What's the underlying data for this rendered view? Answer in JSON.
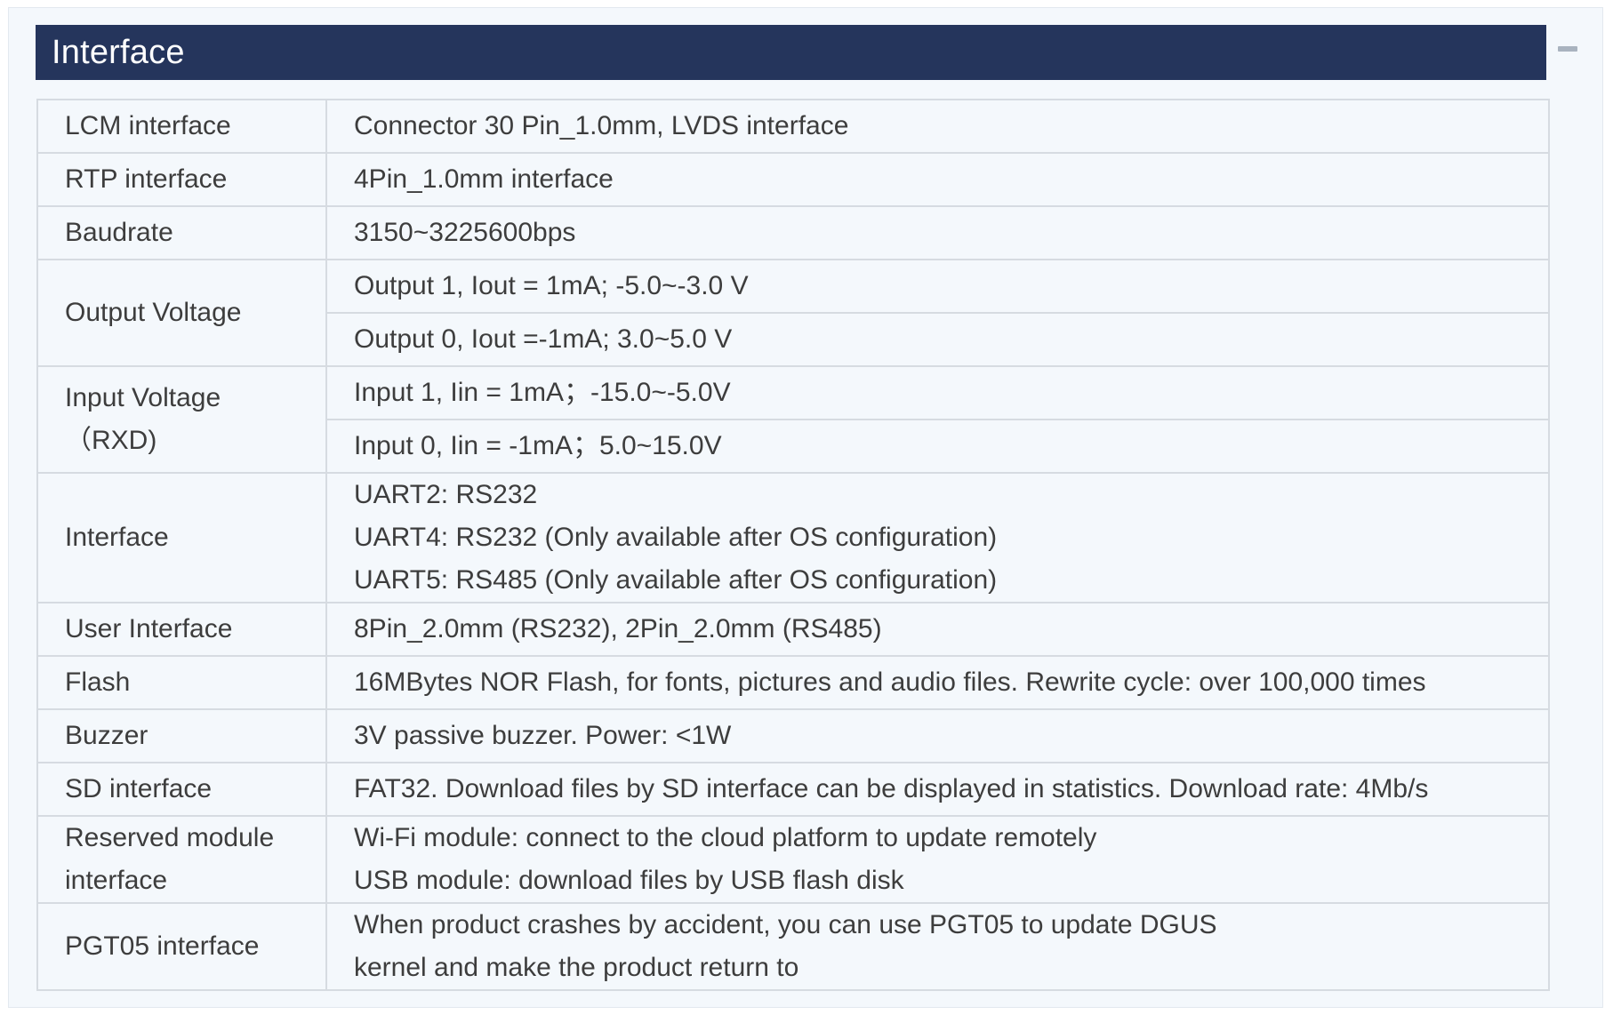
{
  "section": {
    "title": "Interface"
  },
  "table": {
    "lcm": {
      "label": "LCM interface",
      "value": "Connector 30 Pin_1.0mm, LVDS interface"
    },
    "rtp": {
      "label": "RTP interface",
      "value": "4Pin_1.0mm interface"
    },
    "baudrate": {
      "label": "Baudrate",
      "value": "3150~3225600bps"
    },
    "output_voltage": {
      "label": "Output Voltage",
      "values": [
        "Output 1, Iout = 1mA; -5.0~-3.0 V",
        "Output 0, Iout =-1mA; 3.0~5.0 V"
      ]
    },
    "input_voltage": {
      "label_lines": [
        "Input Voltage",
        "（RXD)"
      ],
      "values": [
        "Input 1, Iin = 1mA；-15.0~-5.0V",
        "Input 0, Iin = -1mA；5.0~15.0V"
      ]
    },
    "interface": {
      "label": "Interface",
      "lines": [
        "UART2: RS232",
        "UART4: RS232 (Only available after OS configuration)",
        "UART5: RS485 (Only available after OS configuration)"
      ]
    },
    "user_interface": {
      "label": "User Interface",
      "value": "8Pin_2.0mm (RS232), 2Pin_2.0mm (RS485)"
    },
    "flash": {
      "label": "Flash",
      "value": "16MBytes NOR Flash, for fonts, pictures and audio files. Rewrite cycle: over 100,000 times"
    },
    "buzzer": {
      "label": "Buzzer",
      "value": "3V passive buzzer. Power: <1W"
    },
    "sd": {
      "label": "SD interface",
      "value": "FAT32. Download files by SD interface can be displayed in statistics. Download rate: 4Mb/s"
    },
    "reserved": {
      "label_lines": [
        "Reserved module",
        "interface"
      ],
      "lines": [
        "Wi-Fi module: connect to the cloud platform to update remotely",
        "USB module: download files by USB flash disk"
      ]
    },
    "pgt05": {
      "label": "PGT05 interface",
      "lines": [
        "When product crashes by accident, you can use PGT05 to update DGUS",
        "kernel and make the product return to"
      ]
    }
  },
  "colors": {
    "header_bg": "#25355c",
    "panel_bg": "#f4f8fc",
    "border": "#d6dbe1",
    "text": "#3d3d3d"
  }
}
